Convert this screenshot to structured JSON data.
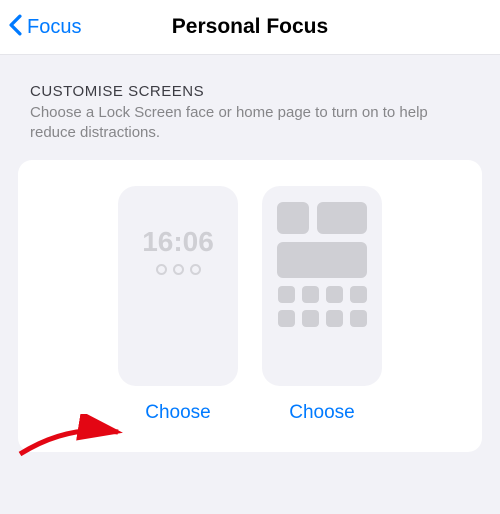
{
  "nav": {
    "back_label": "Focus",
    "title": "Personal Focus"
  },
  "section": {
    "title": "CUSTOMISE SCREENS",
    "description": "Choose a Lock Screen face or home page to turn on to help reduce distractions."
  },
  "lock_preview": {
    "time": "16:06"
  },
  "buttons": {
    "choose_lock": "Choose",
    "choose_home": "Choose"
  }
}
